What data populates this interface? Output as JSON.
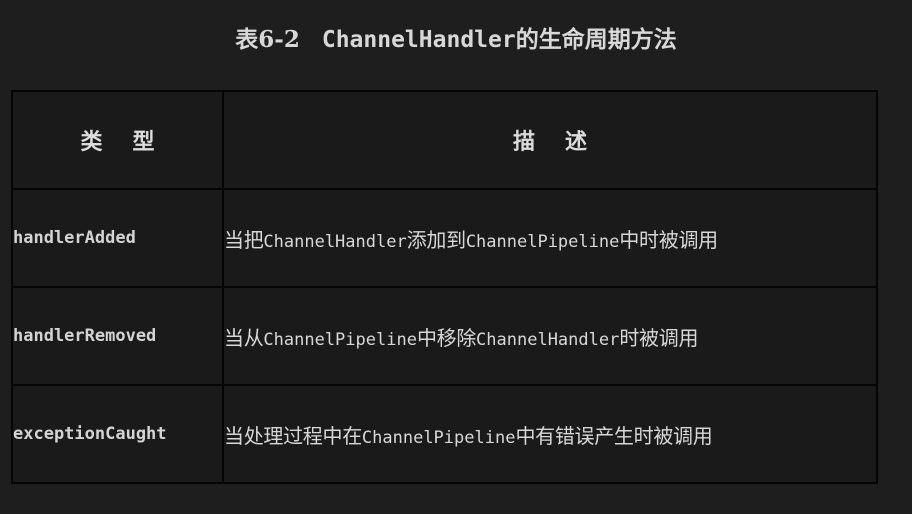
{
  "caption": {
    "prefix": "表6-2",
    "code": "ChannelHandler",
    "rest": "的生命周期方法"
  },
  "table": {
    "headers": [
      "类型",
      "描述"
    ],
    "rows": [
      {
        "type": "handlerAdded",
        "desc": [
          {
            "text": "当把"
          },
          {
            "text": "ChannelHandler",
            "mono": true
          },
          {
            "text": "添加到"
          },
          {
            "text": "ChannelPipeline",
            "mono": true
          },
          {
            "text": "中时被调用"
          }
        ]
      },
      {
        "type": "handlerRemoved",
        "desc": [
          {
            "text": "当从"
          },
          {
            "text": "ChannelPipeline",
            "mono": true
          },
          {
            "text": "中移除"
          },
          {
            "text": "ChannelHandler",
            "mono": true
          },
          {
            "text": "时被调用"
          }
        ]
      },
      {
        "type": "exceptionCaught",
        "desc": [
          {
            "text": "当处理过程中在"
          },
          {
            "text": "ChannelPipeline",
            "mono": true
          },
          {
            "text": "中有错误产生时被调用"
          }
        ]
      }
    ]
  }
}
